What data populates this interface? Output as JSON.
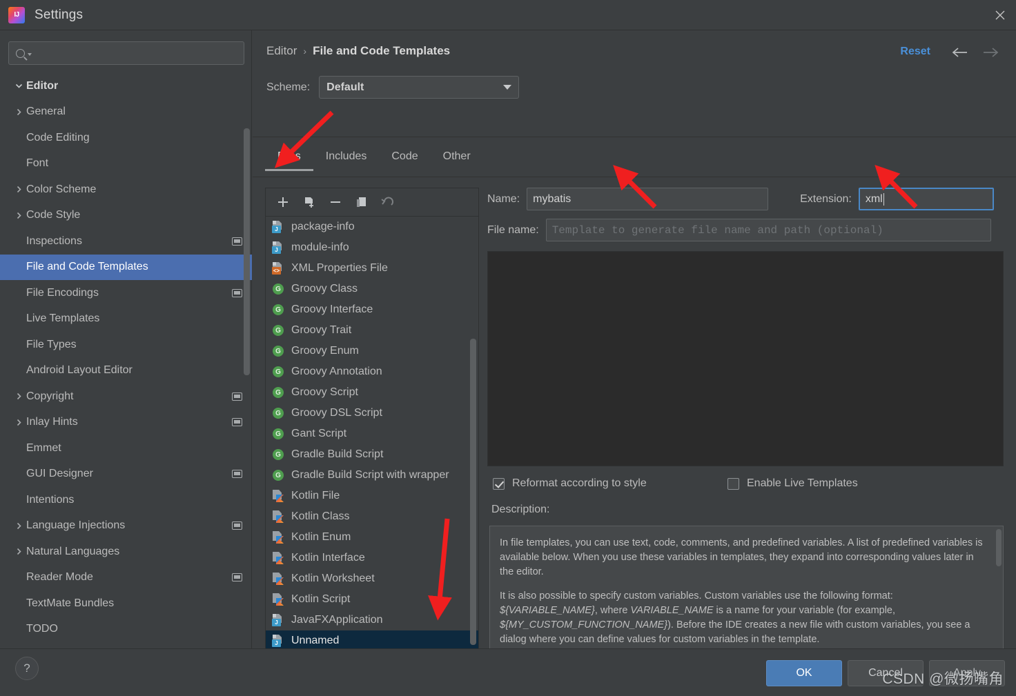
{
  "window": {
    "title": "Settings",
    "logo_text": "IJ",
    "close_label": "✕"
  },
  "sidebar": {
    "search_placeholder": "",
    "items": [
      {
        "label": "Editor",
        "level": 0,
        "arrow": "down",
        "selected": false,
        "monitor": false
      },
      {
        "label": "General",
        "level": 1,
        "arrow": "right",
        "selected": false,
        "monitor": false
      },
      {
        "label": "Code Editing",
        "level": 1,
        "arrow": "none",
        "selected": false,
        "monitor": false
      },
      {
        "label": "Font",
        "level": 1,
        "arrow": "none",
        "selected": false,
        "monitor": false
      },
      {
        "label": "Color Scheme",
        "level": 1,
        "arrow": "right",
        "selected": false,
        "monitor": false
      },
      {
        "label": "Code Style",
        "level": 1,
        "arrow": "right",
        "selected": false,
        "monitor": false
      },
      {
        "label": "Inspections",
        "level": 1,
        "arrow": "none",
        "selected": false,
        "monitor": true
      },
      {
        "label": "File and Code Templates",
        "level": 1,
        "arrow": "none",
        "selected": true,
        "monitor": false
      },
      {
        "label": "File Encodings",
        "level": 1,
        "arrow": "none",
        "selected": false,
        "monitor": true
      },
      {
        "label": "Live Templates",
        "level": 1,
        "arrow": "none",
        "selected": false,
        "monitor": false
      },
      {
        "label": "File Types",
        "level": 1,
        "arrow": "none",
        "selected": false,
        "monitor": false
      },
      {
        "label": "Android Layout Editor",
        "level": 1,
        "arrow": "none",
        "selected": false,
        "monitor": false
      },
      {
        "label": "Copyright",
        "level": 1,
        "arrow": "right",
        "selected": false,
        "monitor": true
      },
      {
        "label": "Inlay Hints",
        "level": 1,
        "arrow": "right",
        "selected": false,
        "monitor": true
      },
      {
        "label": "Emmet",
        "level": 1,
        "arrow": "none",
        "selected": false,
        "monitor": false
      },
      {
        "label": "GUI Designer",
        "level": 1,
        "arrow": "none",
        "selected": false,
        "monitor": true
      },
      {
        "label": "Intentions",
        "level": 1,
        "arrow": "none",
        "selected": false,
        "monitor": false
      },
      {
        "label": "Language Injections",
        "level": 1,
        "arrow": "right",
        "selected": false,
        "monitor": true
      },
      {
        "label": "Natural Languages",
        "level": 1,
        "arrow": "right",
        "selected": false,
        "monitor": false
      },
      {
        "label": "Reader Mode",
        "level": 1,
        "arrow": "none",
        "selected": false,
        "monitor": true
      },
      {
        "label": "TextMate Bundles",
        "level": 1,
        "arrow": "none",
        "selected": false,
        "monitor": false
      },
      {
        "label": "TODO",
        "level": 1,
        "arrow": "none",
        "selected": false,
        "monitor": false
      }
    ]
  },
  "header": {
    "breadcrumb_root": "Editor",
    "breadcrumb_sep": "›",
    "breadcrumb_leaf": "File and Code Templates",
    "reset_label": "Reset",
    "back_icon": "←",
    "forward_icon": "→"
  },
  "scheme": {
    "label": "Scheme:",
    "value": "Default"
  },
  "tabs": [
    {
      "label": "Files",
      "active": true
    },
    {
      "label": "Includes",
      "active": false
    },
    {
      "label": "Code",
      "active": false
    },
    {
      "label": "Other",
      "active": false
    }
  ],
  "list_toolbar": [
    {
      "name": "add-template-button",
      "glyph": "+",
      "disabled": false
    },
    {
      "name": "copy-template-button",
      "glyph": "cp",
      "disabled": false
    },
    {
      "name": "remove-template-button",
      "glyph": "−",
      "disabled": false
    },
    {
      "name": "duplicate-template-button",
      "glyph": "du",
      "disabled": false
    },
    {
      "name": "reset-template-button",
      "glyph": "↺",
      "disabled": true
    }
  ],
  "templates": [
    {
      "label": "package-info",
      "icon": "java",
      "selected": false
    },
    {
      "label": "module-info",
      "icon": "java",
      "selected": false
    },
    {
      "label": "XML Properties File",
      "icon": "xml",
      "selected": false
    },
    {
      "label": "Groovy Class",
      "icon": "groovy",
      "selected": false
    },
    {
      "label": "Groovy Interface",
      "icon": "groovy",
      "selected": false
    },
    {
      "label": "Groovy Trait",
      "icon": "groovy",
      "selected": false
    },
    {
      "label": "Groovy Enum",
      "icon": "groovy",
      "selected": false
    },
    {
      "label": "Groovy Annotation",
      "icon": "groovy",
      "selected": false
    },
    {
      "label": "Groovy Script",
      "icon": "groovy",
      "selected": false
    },
    {
      "label": "Groovy DSL Script",
      "icon": "groovy",
      "selected": false
    },
    {
      "label": "Gant Script",
      "icon": "groovy",
      "selected": false
    },
    {
      "label": "Gradle Build Script",
      "icon": "groovy",
      "selected": false
    },
    {
      "label": "Gradle Build Script with wrapper",
      "icon": "groovy",
      "selected": false
    },
    {
      "label": "Kotlin File",
      "icon": "kotlin",
      "selected": false
    },
    {
      "label": "Kotlin Class",
      "icon": "kotlin",
      "selected": false
    },
    {
      "label": "Kotlin Enum",
      "icon": "kotlin",
      "selected": false
    },
    {
      "label": "Kotlin Interface",
      "icon": "kotlin",
      "selected": false
    },
    {
      "label": "Kotlin Worksheet",
      "icon": "kotlin",
      "selected": false
    },
    {
      "label": "Kotlin Script",
      "icon": "kotlin",
      "selected": false
    },
    {
      "label": "JavaFXApplication",
      "icon": "java",
      "selected": false
    },
    {
      "label": "Unnamed",
      "icon": "java",
      "selected": true
    }
  ],
  "form": {
    "name_label": "Name:",
    "name_value": "mybatis",
    "extension_label": "Extension:",
    "extension_value": "xml",
    "file_name_label": "File name:",
    "file_name_placeholder": "Template to generate file name and path (optional)",
    "editor_content": "",
    "reformat_label": "Reformat according to style",
    "reformat_checked": true,
    "live_templates_label": "Enable Live Templates",
    "live_templates_checked": false,
    "description_label": "Description:",
    "description_p1": "In file templates, you can use text, code, comments, and predefined variables. A list of predefined variables is available below. When you use these variables in templates, they expand into corresponding values later in the editor.",
    "description_p2_a": "It is also possible to specify custom variables. Custom variables use the following format: ",
    "description_p2_var1": "${VARIABLE_NAME}",
    "description_p2_b": ", where ",
    "description_p2_var2": "VARIABLE_NAME",
    "description_p2_c": " is a name for your variable (for example, ",
    "description_p2_var3": "${MY_CUSTOM_FUNCTION_NAME}",
    "description_p2_d": "). Before the IDE creates a new file with custom variables, you see a dialog where you can define values for custom variables in the template."
  },
  "footer": {
    "help_label": "?",
    "ok_label": "OK",
    "cancel_label": "Cancel",
    "apply_label": "Apply"
  },
  "watermark": "CSDN @微扬嘴角",
  "colors": {
    "accent_blue": "#4a90d9",
    "selection_blue": "#4b6eaf",
    "list_selection": "#0d293e",
    "focus_border": "#4a88c7",
    "arrow_red": "#f01f1f"
  }
}
